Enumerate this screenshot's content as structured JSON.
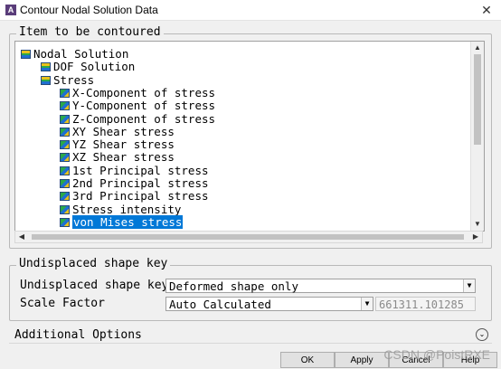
{
  "window": {
    "title": "Contour Nodal Solution Data",
    "app_icon_text": "A",
    "close_glyph": "✕"
  },
  "item_group": {
    "label": "Item to be contoured"
  },
  "tree": {
    "items": [
      {
        "label": "Nodal Solution",
        "level": 0,
        "icon": "folder-icon"
      },
      {
        "label": "DOF Solution",
        "level": 1,
        "icon": "folder-icon"
      },
      {
        "label": "Stress",
        "level": 1,
        "icon": "folder-icon"
      },
      {
        "label": "X-Component of stress",
        "level": 2,
        "icon": "stress-icon"
      },
      {
        "label": "Y-Component of stress",
        "level": 2,
        "icon": "stress-icon"
      },
      {
        "label": "Z-Component of stress",
        "level": 2,
        "icon": "stress-icon"
      },
      {
        "label": "XY Shear stress",
        "level": 2,
        "icon": "stress-icon"
      },
      {
        "label": "YZ Shear stress",
        "level": 2,
        "icon": "stress-icon"
      },
      {
        "label": "XZ Shear stress",
        "level": 2,
        "icon": "stress-icon"
      },
      {
        "label": "1st Principal stress",
        "level": 2,
        "icon": "stress-icon"
      },
      {
        "label": "2nd Principal stress",
        "level": 2,
        "icon": "stress-icon"
      },
      {
        "label": "3rd Principal stress",
        "level": 2,
        "icon": "stress-icon"
      },
      {
        "label": "Stress intensity",
        "level": 2,
        "icon": "stress-icon"
      },
      {
        "label": "von Mises stress",
        "level": 2,
        "icon": "stress-icon",
        "selected": true
      }
    ]
  },
  "shape_group": {
    "label": "Undisplaced shape key",
    "shape_key_label": "Undisplaced shape key",
    "shape_key_value": "Deformed shape only",
    "scale_label": "Scale Factor",
    "scale_value": "Auto Calculated",
    "scale_number": "661311.101285"
  },
  "additional": {
    "label": "Additional Options",
    "expand_glyph": "⌄"
  },
  "buttons": {
    "ok": "OK",
    "apply": "Apply",
    "cancel": "Cancel",
    "help": "Help"
  },
  "watermark": "CSDN @PoistRXE"
}
